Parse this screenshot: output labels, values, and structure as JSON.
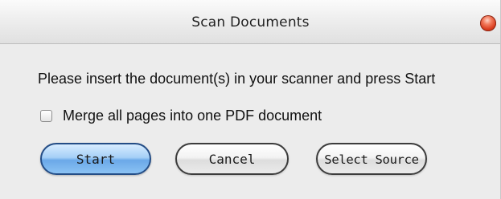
{
  "window": {
    "title": "Scan Documents"
  },
  "dialog": {
    "message": "Please insert the document(s) in your scanner and press Start",
    "merge_checkbox": {
      "label": "Merge all pages into one PDF document",
      "checked": false
    }
  },
  "buttons": {
    "start_label": "Start",
    "cancel_label": "Cancel",
    "select_source_label": "Select Source"
  },
  "colors": {
    "primary_button": "#8cc3f4",
    "close_button": "#d93a1c",
    "window_background": "#ececec"
  },
  "icons": {
    "close": "close-icon"
  }
}
